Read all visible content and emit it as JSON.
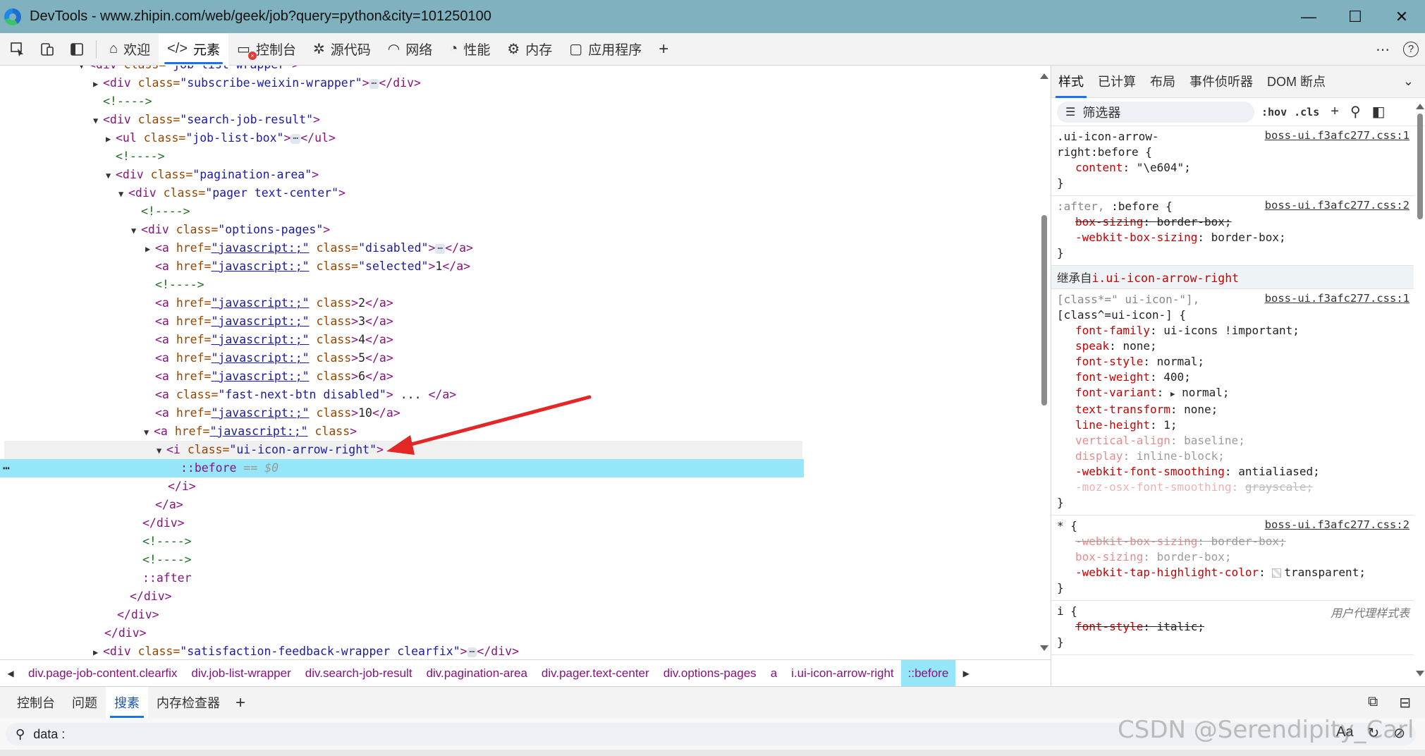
{
  "window": {
    "title": "DevTools - www.zhipin.com/web/geek/job?query=python&city=101250100",
    "minimize": "—",
    "maximize": "☐",
    "close": "✕"
  },
  "toolbar": {
    "tabs": [
      {
        "label": "欢迎",
        "icon": "home-icon"
      },
      {
        "label": "元素",
        "icon": "code-icon"
      },
      {
        "label": "控制台",
        "icon": "console-icon"
      },
      {
        "label": "源代码",
        "icon": "bug-icon"
      },
      {
        "label": "网络",
        "icon": "wifi-icon"
      },
      {
        "label": "性能",
        "icon": "gauge-icon"
      },
      {
        "label": "内存",
        "icon": "memory-icon"
      },
      {
        "label": "应用程序",
        "icon": "app-icon"
      }
    ],
    "active_tab": "元素",
    "more": "⋯",
    "help": "?"
  },
  "dom_tree": {
    "line0": {
      "tag_open": "<div ",
      "attr": "class=",
      "val": "\"job-list-wrapper\"",
      "close": ">"
    },
    "line1": {
      "tag": "<div ",
      "attr": "class=",
      "val": "\"subscribe-weixin-wrapper\"",
      "gt": ">",
      "dots": "⋯",
      "end": "</div>"
    },
    "line2": {
      "comment": "<!---->"
    },
    "line3": {
      "tag": "<div ",
      "attr": "class=",
      "val": "\"search-job-result\"",
      "gt": ">"
    },
    "line4": {
      "tag": "<ul ",
      "attr": "class=",
      "val": "\"job-list-box\"",
      "gt": ">",
      "dots": "⋯",
      "end": "</ul>"
    },
    "line5": {
      "comment": "<!---->"
    },
    "line6": {
      "tag": "<div ",
      "attr": "class=",
      "val": "\"pagination-area\"",
      "gt": ">"
    },
    "line7": {
      "tag": "<div ",
      "attr": "class=",
      "val": "\"pager text-center\"",
      "gt": ">"
    },
    "line8": {
      "comment": "<!---->"
    },
    "line9": {
      "tag": "<div ",
      "attr": "class=",
      "val": "\"options-pages\"",
      "gt": ">"
    },
    "line10": {
      "tag": "<a ",
      "a1": "href=",
      "v1": "\"javascript:;\"",
      "a2": " class=",
      "v2": "\"disabled\"",
      "gt": ">",
      "dots": "⋯",
      "end": "</a>"
    },
    "line11": {
      "tag": "<a ",
      "a1": "href=",
      "v1": "\"javascript:;\"",
      "a2": " class=",
      "v2": "\"selected\"",
      "gt": ">",
      "text": "1",
      "end": "</a>"
    },
    "line12": {
      "comment": "<!---->"
    },
    "line13": {
      "tag": "<a ",
      "a1": "href=",
      "v1": "\"javascript:;\"",
      "a2": " class",
      "gt": ">",
      "text": "2",
      "end": "</a>"
    },
    "line14": {
      "tag": "<a ",
      "a1": "href=",
      "v1": "\"javascript:;\"",
      "a2": " class",
      "gt": ">",
      "text": "3",
      "end": "</a>"
    },
    "line15": {
      "tag": "<a ",
      "a1": "href=",
      "v1": "\"javascript:;\"",
      "a2": " class",
      "gt": ">",
      "text": "4",
      "end": "</a>"
    },
    "line16": {
      "tag": "<a ",
      "a1": "href=",
      "v1": "\"javascript:;\"",
      "a2": " class",
      "gt": ">",
      "text": "5",
      "end": "</a>"
    },
    "line17": {
      "tag": "<a ",
      "a1": "href=",
      "v1": "\"javascript:;\"",
      "a2": " class",
      "gt": ">",
      "text": "6",
      "end": "</a>"
    },
    "line18": {
      "tag": "<a ",
      "attr": "class=",
      "val": "\"fast-next-btn disabled\"",
      "gt": ">",
      "text": " ... ",
      "end": "</a>"
    },
    "line19": {
      "tag": "<a ",
      "a1": "href=",
      "v1": "\"javascript:;\"",
      "a2": " class",
      "gt": ">",
      "text": "10",
      "end": "</a>"
    },
    "line20": {
      "tag": "<a ",
      "a1": "href=",
      "v1": "\"javascript:;\"",
      "a2": " class",
      "gt": ">"
    },
    "line21": {
      "tag": "<i ",
      "attr": "class=",
      "val": "\"ui-icon-arrow-right\"",
      "gt": ">"
    },
    "line22": {
      "pseudo": "::before",
      "eq": " == $0",
      "gutter": "⋯"
    },
    "line23": {
      "end": "</i>"
    },
    "line24": {
      "end": "</a>"
    },
    "line25": {
      "end": "</div>"
    },
    "line26": {
      "comment": "<!---->"
    },
    "line27": {
      "comment": "<!---->"
    },
    "line28": {
      "pseudo": "::after"
    },
    "line29": {
      "end": "</div>"
    },
    "line30": {
      "end": "</div>"
    },
    "line31": {
      "end": "</div>"
    },
    "line32": {
      "tag": "<div ",
      "attr": "class=",
      "val": "\"satisfaction-feedback-wrapper clearfix\"",
      "gt": ">",
      "dots": "⋯",
      "end": "</div>"
    }
  },
  "breadcrumb": [
    "div.page-job-content.clearfix",
    "div.job-list-wrapper",
    "div.search-job-result",
    "div.pagination-area",
    "div.pager.text-center",
    "div.options-pages",
    "a",
    "i.ui-icon-arrow-right",
    "::before"
  ],
  "styles_pane": {
    "tabs": [
      "样式",
      "已计算",
      "布局",
      "事件侦听器",
      "DOM 断点"
    ],
    "active_tab": "样式",
    "filter_placeholder": "筛选器",
    "hov": ":hov",
    "cls": ".cls",
    "rules": {
      "r1": {
        "selector": ".ui-icon-arrow-\nright:before {",
        "source": "boss-ui.f3afc277.css:1",
        "decls": [
          {
            "name": "content",
            "value": "\"\\e604\";"
          }
        ]
      },
      "r2": {
        "selector_dim": ":after, ",
        "selector": ":before {",
        "source": "boss-ui.f3afc277.css:2",
        "decls": [
          {
            "name": "box-sizing",
            "value": "border-box;"
          },
          {
            "name": "-webkit-box-sizing",
            "value": "border-box;"
          }
        ]
      },
      "inherit_label": "继承自",
      "inherit_class": "i.ui-icon-arrow-right",
      "r3": {
        "selector_dim": "[class*=\" ui-icon-\"],",
        "selector": "[class^=ui-icon-] {",
        "source": "boss-ui.f3afc277.css:1",
        "decls": [
          {
            "name": "font-family",
            "value": "ui-icons !important;"
          },
          {
            "name": "speak",
            "value": "none;"
          },
          {
            "name": "font-style",
            "value": "normal;"
          },
          {
            "name": "font-weight",
            "value": "400;"
          },
          {
            "name": "font-variant",
            "value": "normal;"
          },
          {
            "name": "text-transform",
            "value": "none;"
          },
          {
            "name": "line-height",
            "value": "1;"
          },
          {
            "name": "vertical-align",
            "value": "baseline;"
          },
          {
            "name": "display",
            "value": "inline-block;"
          },
          {
            "name": "-webkit-font-smoothing",
            "value": "antialiased;"
          },
          {
            "name": "-moz-osx-font-smoothing",
            "value": "grayscale;"
          }
        ]
      },
      "r4": {
        "selector": "* {",
        "source": "boss-ui.f3afc277.css:2",
        "decls": [
          {
            "name": "-webkit-box-sizing",
            "value": "border-box;"
          },
          {
            "name": "box-sizing",
            "value": "border-box;"
          },
          {
            "name": "-webkit-tap-highlight-color",
            "value": "transparent;"
          }
        ]
      },
      "r5": {
        "selector": "i {",
        "source": "用户代理样式表",
        "decls": [
          {
            "name": "font-style",
            "value": "italic;"
          }
        ]
      },
      "close_brace": "}"
    }
  },
  "drawer": {
    "tabs": [
      "控制台",
      "问题",
      "搜素",
      "内存检查器"
    ],
    "active_tab": "搜素",
    "search_value": "data :",
    "watermark": "CSDN @Serendipity_Carl"
  },
  "colors": {
    "titlebar": "#7fb1bf",
    "selected_row": "#95e6f9",
    "accent": "#1a73e8",
    "annotation_arrow": "#e32626"
  }
}
